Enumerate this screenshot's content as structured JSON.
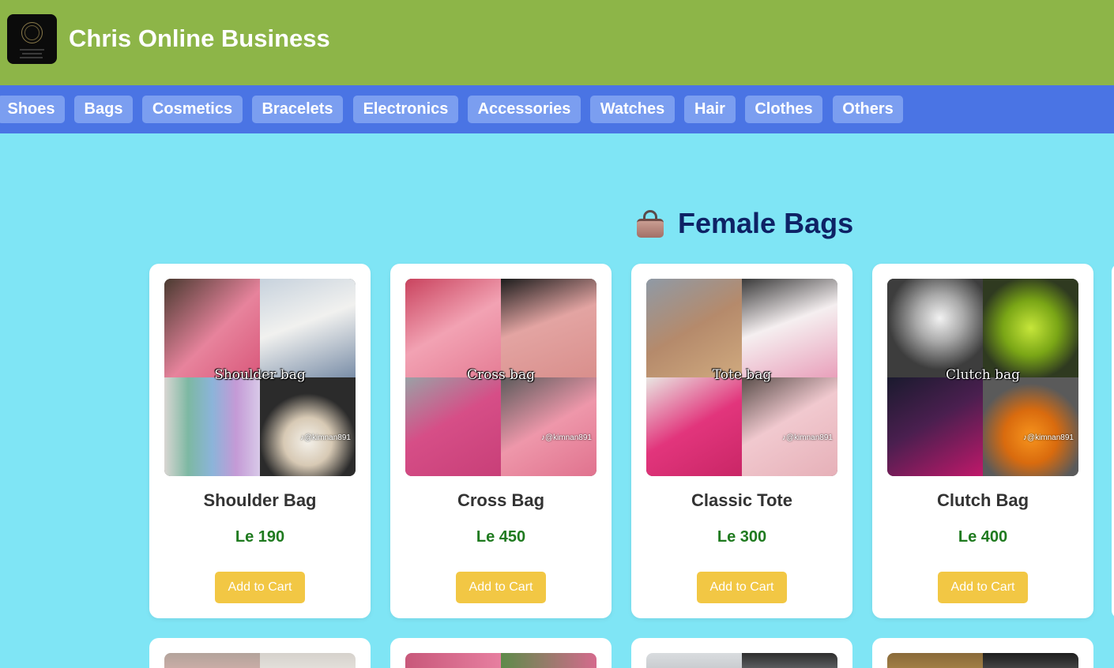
{
  "site": {
    "title": "Chris Online Business"
  },
  "nav": {
    "items": [
      "Shoes",
      "Bags",
      "Cosmetics",
      "Bracelets",
      "Electronics",
      "Accessories",
      "Watches",
      "Hair",
      "Clothes",
      "Others"
    ]
  },
  "section": {
    "icon": "handbag-icon",
    "title": "Female Bags"
  },
  "products": [
    {
      "name": "Shoulder Bag",
      "price": "Le 190",
      "image_caption": "Shoulder bag",
      "image_tag": "♪@kimnan891",
      "button": "Add to Cart"
    },
    {
      "name": "Cross Bag",
      "price": "Le 450",
      "image_caption": "Cross bag",
      "image_tag": "♪@kimnan891",
      "button": "Add to Cart"
    },
    {
      "name": "Classic Tote",
      "price": "Le 300",
      "image_caption": "Tote bag",
      "image_tag": "♪@kimnan891",
      "button": "Add to Cart"
    },
    {
      "name": "Clutch Bag",
      "price": "Le 400",
      "image_caption": "Clutch bag",
      "image_tag": "♪@kimnan891",
      "button": "Add to Cart"
    }
  ],
  "colors": {
    "header_bg": "#8db548",
    "nav_bg": "#4a74e4",
    "nav_item_bg": "#7b9ef0",
    "page_bg": "#7fe5f5",
    "title_color": "#0e2265",
    "price_color": "#1f7a1f",
    "button_bg": "#f2c744"
  }
}
